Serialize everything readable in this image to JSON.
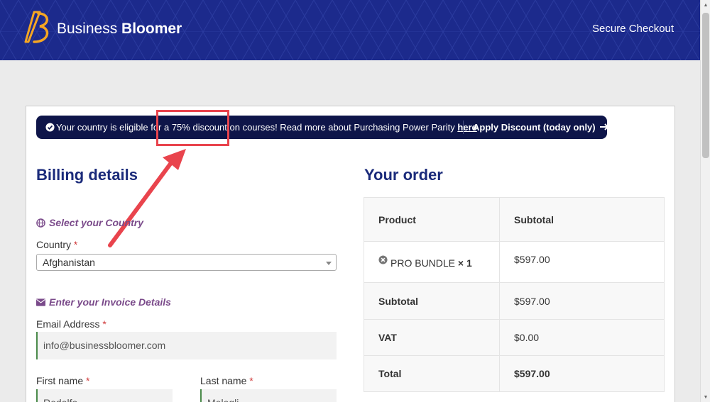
{
  "header": {
    "brand_light": "Business ",
    "brand_bold": "Bloomer",
    "secure_label": "Secure Checkout",
    "colors": {
      "background": "#1c2a8c",
      "logo": "#f5a623"
    }
  },
  "banner": {
    "text": "Your country is eligible for a 75% discount on courses! Read more about Purchasing Power Parity ",
    "link_text": "here",
    "link_suffix": ".",
    "apply_label": "Apply Discount (today only)",
    "apply_icon": "arrow-right-icon",
    "check_icon": "check-circle-icon"
  },
  "billing": {
    "title": "Billing details",
    "country_section": {
      "label": "Select your Country",
      "icon": "globe-icon"
    },
    "country": {
      "label": "Country",
      "required": "*",
      "value": "Afghanistan"
    },
    "invoice_section": {
      "label": "Enter your Invoice Details",
      "icon": "envelope-icon"
    },
    "email": {
      "label": "Email Address",
      "required": "*",
      "value": "info@businessbloomer.com"
    },
    "first_name": {
      "label": "First name",
      "required": "*",
      "value": "Rodolfo"
    },
    "last_name": {
      "label": "Last name",
      "required": "*",
      "value": "Melogli"
    }
  },
  "order": {
    "title": "Your order",
    "head": {
      "product": "Product",
      "subtotal": "Subtotal"
    },
    "item": {
      "name": "PRO BUNDLE",
      "qty": "× 1",
      "price": "$597.00",
      "remove_icon": "remove-circle-icon"
    },
    "subtotal": {
      "label": "Subtotal",
      "value": "$597.00"
    },
    "vat": {
      "label": "VAT",
      "value": "$0.00"
    },
    "total": {
      "label": "Total",
      "value": "$597.00"
    }
  }
}
